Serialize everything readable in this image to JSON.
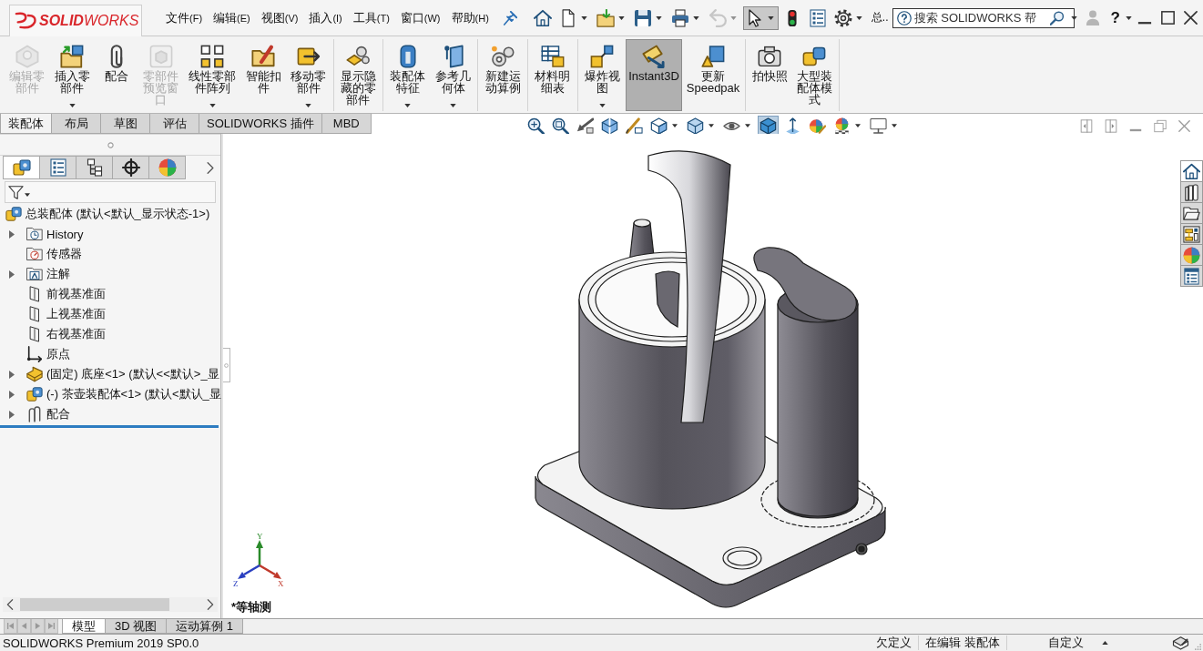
{
  "title_bar": {
    "logo": "**SOLID**WORKS",
    "menus": [
      {
        "label": "文件",
        "key": "(F)"
      },
      {
        "label": "编辑",
        "key": "(E)"
      },
      {
        "label": "视图",
        "key": "(V)"
      },
      {
        "label": "插入",
        "key": "(I)"
      },
      {
        "label": "工具",
        "key": "(T)"
      },
      {
        "label": "窗口",
        "key": "(W)"
      },
      {
        "label": "帮助",
        "key": "(H)"
      }
    ],
    "quick_tools": [
      {
        "dropdown": false,
        "selected": false,
        "disabled": false
      },
      {
        "dropdown": true,
        "selected": false,
        "disabled": false
      },
      {
        "dropdown": true,
        "selected": false,
        "disabled": false
      },
      {
        "dropdown": true,
        "selected": false,
        "disabled": false
      },
      {
        "dropdown": true,
        "selected": false,
        "disabled": false
      },
      {
        "dropdown": true,
        "selected": false,
        "disabled": true
      },
      {
        "dropdown": true,
        "selected": true,
        "disabled": false
      },
      {
        "dropdown": false,
        "selected": false,
        "disabled": false
      },
      {
        "dropdown": false,
        "selected": false,
        "disabled": false
      },
      {
        "dropdown": true,
        "selected": false,
        "disabled": false
      }
    ],
    "document_name": "总..",
    "search": {
      "placeholder": "搜索 SOLIDWORKS 帮"
    },
    "help": "?"
  },
  "ribbon": {
    "groups": [
      {
        "buttons": [
          {
            "label": "编辑零部件",
            "disabled": true,
            "selected": false,
            "dropdown": false
          },
          {
            "label": "插入零部件",
            "disabled": false,
            "selected": false,
            "dropdown": true
          },
          {
            "label": "配合",
            "disabled": false,
            "selected": false,
            "dropdown": false
          },
          {
            "label": "零部件预览窗口",
            "disabled": true,
            "selected": false,
            "dropdown": false
          },
          {
            "label": "线性零部件阵列",
            "disabled": false,
            "selected": false,
            "dropdown": true
          },
          {
            "label": "智能扣件",
            "disabled": false,
            "selected": false,
            "dropdown": false
          },
          {
            "label": "移动零部件",
            "disabled": false,
            "selected": false,
            "dropdown": true
          }
        ]
      },
      {
        "buttons": [
          {
            "label": "显示隐藏的零部件",
            "disabled": false,
            "selected": false,
            "dropdown": false
          }
        ]
      },
      {
        "buttons": [
          {
            "label": "装配体特征",
            "disabled": false,
            "selected": false,
            "dropdown": true
          },
          {
            "label": "参考几何体",
            "disabled": false,
            "selected": false,
            "dropdown": true
          }
        ]
      },
      {
        "buttons": [
          {
            "label": "新建运动算例",
            "disabled": false,
            "selected": false,
            "dropdown": false
          }
        ]
      },
      {
        "buttons": [
          {
            "label": "材料明细表",
            "disabled": false,
            "selected": false,
            "dropdown": false
          }
        ]
      },
      {
        "buttons": [
          {
            "label": "爆炸视图",
            "disabled": false,
            "selected": false,
            "dropdown": true
          },
          {
            "label": "Instant3D",
            "disabled": false,
            "selected": true,
            "dropdown": false
          },
          {
            "label": "更新 Speedpak",
            "disabled": false,
            "selected": false,
            "dropdown": false
          }
        ]
      },
      {
        "buttons": [
          {
            "label": "拍快照",
            "disabled": false,
            "selected": false,
            "dropdown": false
          },
          {
            "label": "大型装配体模式",
            "disabled": false,
            "selected": false,
            "dropdown": false
          }
        ]
      }
    ]
  },
  "command_tabs": [
    {
      "label": "装配体",
      "selected": true
    },
    {
      "label": "布局",
      "selected": false
    },
    {
      "label": "草图",
      "selected": false
    },
    {
      "label": "评估",
      "selected": false
    },
    {
      "label": "SOLIDWORKS 插件",
      "selected": false
    },
    {
      "label": "MBD",
      "selected": false
    }
  ],
  "view_toolbar": [
    {
      "dropdown": false,
      "selected": false
    },
    {
      "dropdown": false,
      "selected": false
    },
    {
      "dropdown": false,
      "selected": false
    },
    {
      "dropdown": false,
      "selected": false
    },
    {
      "dropdown": false,
      "selected": false
    },
    {
      "dropdown": true,
      "selected": false
    },
    {
      "dropdown": true,
      "selected": false
    },
    {
      "dropdown": true,
      "selected": false
    },
    {
      "dropdown": false,
      "selected": true
    },
    {
      "dropdown": false,
      "selected": false
    },
    {
      "dropdown": false,
      "selected": false
    },
    {
      "dropdown": true,
      "selected": false
    },
    {
      "dropdown": true,
      "selected": false
    }
  ],
  "feature_manager": {
    "tabs": [
      {
        "selected": true
      },
      {
        "selected": false
      },
      {
        "selected": false
      },
      {
        "selected": false
      },
      {
        "selected": false
      }
    ],
    "tree": {
      "label": "总装配体 (默认<默认_显示状态-1>)",
      "kind": "assembly",
      "children": [
        {
          "label": "History",
          "kind": "history",
          "expandable": true
        },
        {
          "label": "传感器",
          "kind": "sensors",
          "expandable": false
        },
        {
          "label": "注解",
          "kind": "annotations",
          "expandable": true
        },
        {
          "label": "前视基准面",
          "kind": "plane",
          "expandable": false
        },
        {
          "label": "上视基准面",
          "kind": "plane",
          "expandable": false
        },
        {
          "label": "右视基准面",
          "kind": "plane",
          "expandable": false
        },
        {
          "label": "原点",
          "kind": "origin",
          "expandable": false
        },
        {
          "label": "(固定) 底座<1> (默认<<默认>_显",
          "kind": "part",
          "expandable": true
        },
        {
          "label": "(-) 茶壶装配体<1> (默认<默认_显",
          "kind": "subassembly",
          "expandable": true
        },
        {
          "label": "配合",
          "kind": "mates",
          "expandable": true
        }
      ]
    }
  },
  "graphics": {
    "triad": {
      "x": "X",
      "y": "Y",
      "z": "Z"
    },
    "view_name": "*等轴测",
    "task_pane": [
      {
        "selected": true
      },
      {
        "selected": false
      },
      {
        "selected": false
      },
      {
        "selected": false
      },
      {
        "selected": false
      },
      {
        "selected": false
      }
    ]
  },
  "sheet_tabs": [
    {
      "label": "模型",
      "selected": true
    },
    {
      "label": "3D 视图",
      "selected": false
    },
    {
      "label": "运动算例 1",
      "selected": false
    }
  ],
  "status_bar": {
    "product": "SOLIDWORKS Premium 2019 SP0.0",
    "definition": "欠定义",
    "mode": "在编辑 装配体",
    "units": "自定义"
  }
}
